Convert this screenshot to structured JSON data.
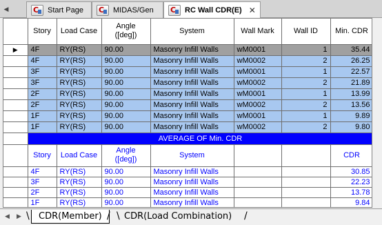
{
  "tabs": [
    {
      "label": "Start Page"
    },
    {
      "label": "MIDAS/Gen"
    },
    {
      "label": "RC Wall CDR(E)"
    }
  ],
  "table": {
    "columns": [
      "Story",
      "Load Case",
      "Angle\n([deg])",
      "System",
      "Wall Mark",
      "Wall ID",
      "Min. CDR"
    ],
    "rows": [
      [
        "4F",
        "RY(RS)",
        "90.00",
        "Masonry Infill Walls",
        "wM0001",
        "1",
        "35.44"
      ],
      [
        "4F",
        "RY(RS)",
        "90.00",
        "Masonry Infill Walls",
        "wM0002",
        "2",
        "26.25"
      ],
      [
        "3F",
        "RY(RS)",
        "90.00",
        "Masonry Infill Walls",
        "wM0001",
        "1",
        "22.57"
      ],
      [
        "3F",
        "RY(RS)",
        "90.00",
        "Masonry Infill Walls",
        "wM0002",
        "2",
        "21.89"
      ],
      [
        "2F",
        "RY(RS)",
        "90.00",
        "Masonry Infill Walls",
        "wM0001",
        "1",
        "13.99"
      ],
      [
        "2F",
        "RY(RS)",
        "90.00",
        "Masonry Infill Walls",
        "wM0002",
        "2",
        "13.56"
      ],
      [
        "1F",
        "RY(RS)",
        "90.00",
        "Masonry Infill Walls",
        "wM0001",
        "1",
        "9.89"
      ],
      [
        "1F",
        "RY(RS)",
        "90.00",
        "Masonry Infill Walls",
        "wM0002",
        "2",
        "9.80"
      ]
    ],
    "average_banner": "AVERAGE OF Min. CDR",
    "avg_columns": [
      "Story",
      "Load Case",
      "Angle\n([deg])",
      "System",
      "",
      "",
      "CDR"
    ],
    "avg_rows": [
      [
        "4F",
        "RY(RS)",
        "90.00",
        "Masonry Infill Walls",
        "",
        "",
        "30.85"
      ],
      [
        "3F",
        "RY(RS)",
        "90.00",
        "Masonry Infill Walls",
        "",
        "",
        "22.23"
      ],
      [
        "2F",
        "RY(RS)",
        "90.00",
        "Masonry Infill Walls",
        "",
        "",
        "13.78"
      ],
      [
        "1F",
        "RY(RS)",
        "90.00",
        "Masonry Infill Walls",
        "",
        "",
        "9.84"
      ]
    ]
  },
  "sheets": [
    {
      "label": "CDR(Member)"
    },
    {
      "label": "CDR(Load Combination)"
    }
  ],
  "colors": {
    "selected_row": "#a0a0a0",
    "row_fill": "#a8c8f0",
    "banner": "#0000ff",
    "avg_text": "#0000ff"
  }
}
